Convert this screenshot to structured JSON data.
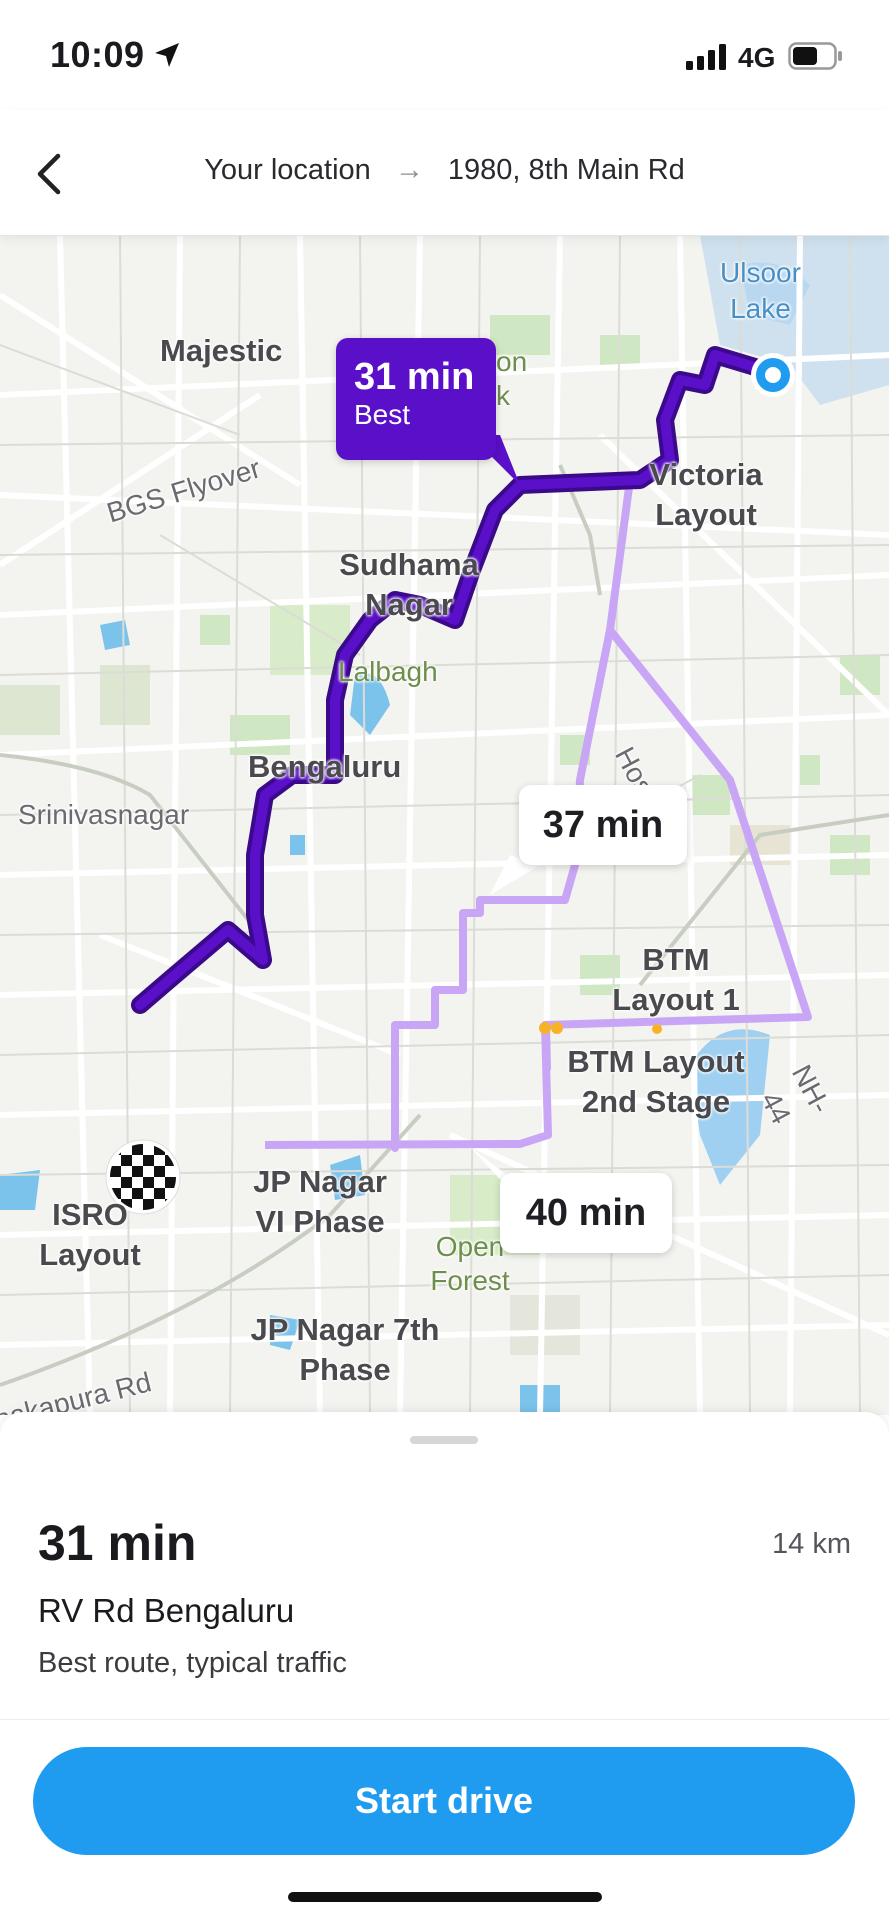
{
  "status_bar": {
    "time": "10:09",
    "network": "4G"
  },
  "header": {
    "origin": "Your location",
    "arrow": "→",
    "destination": "1980, 8th Main Rd"
  },
  "map": {
    "labels": {
      "ulsoor": "Ulsoor\nLake",
      "majestic": "Majestic",
      "cubbon": "on\nk",
      "victoria": "Victoria\nLayout",
      "bgs": "BGS Flyover",
      "sudhama": "Sudhama\nNagar",
      "lalbagh": "Lalbagh",
      "bengaluru": "Bengaluru",
      "srinivasnagar": "Srinivasnagar",
      "hosur": "Hosur Rd",
      "btm1": "BTM\nLayout 1",
      "btm2": "BTM Layout\n2nd Stage",
      "nh44": "NH-44",
      "jpnagar6": "JP Nagar\nVI Phase",
      "isro": "ISRO\nLayout",
      "openforest": "Open\nForest",
      "jpnagar7": "JP Nagar 7th\nPhase",
      "kanakapura": "nakapura Rd"
    },
    "route_bubbles": {
      "best_time": "31 min",
      "best_tag": "Best",
      "alt1_time": "37 min",
      "alt2_time": "40 min"
    }
  },
  "sheet": {
    "eta": "31 min",
    "distance": "14 km",
    "road": "RV Rd Bengaluru",
    "note": "Best route, typical traffic",
    "start_label": "Start drive"
  },
  "colors": {
    "best_route": "#5a0fc8",
    "alt_route": "#c9a6f5",
    "primary_button": "#1f9cf0"
  }
}
